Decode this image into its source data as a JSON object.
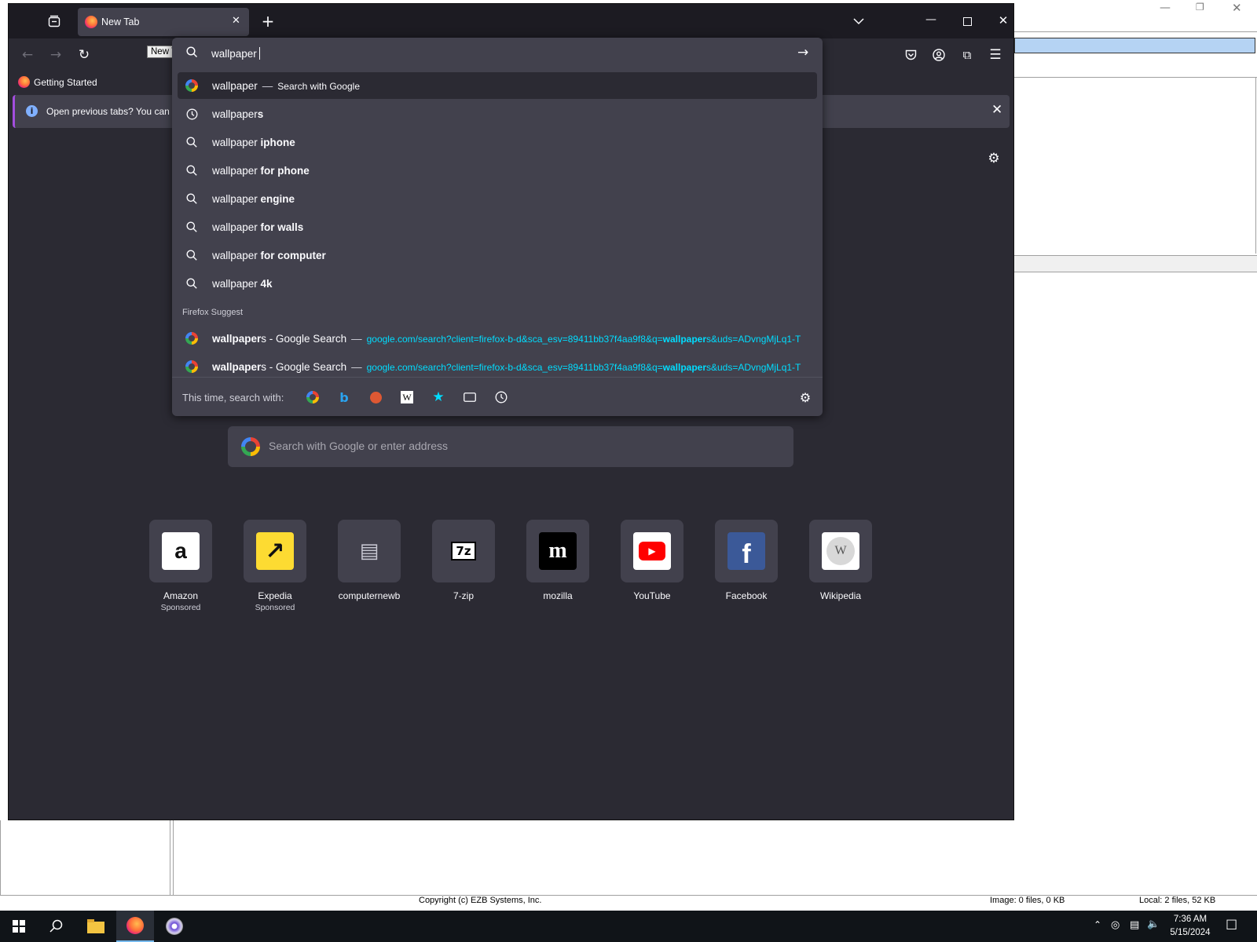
{
  "browser": {
    "tab_title": "New Tab",
    "tooltip": "New Tab",
    "bookmark": "Getting Started",
    "infobar_text": "Open previous tabs? You can re"
  },
  "urlbar": {
    "value": "wallpaper",
    "suggestions": [
      {
        "icon": "google-icon",
        "prefix": "wallpaper",
        "bold": "",
        "action": "Search with Google",
        "selected": true
      },
      {
        "icon": "history-icon",
        "prefix": "wallpaper",
        "bold": "s"
      },
      {
        "icon": "search-icon",
        "prefix": "wallpaper ",
        "bold": "iphone"
      },
      {
        "icon": "search-icon",
        "prefix": "wallpaper ",
        "bold": "for phone"
      },
      {
        "icon": "search-icon",
        "prefix": "wallpaper ",
        "bold": "engine"
      },
      {
        "icon": "search-icon",
        "prefix": "wallpaper ",
        "bold": "for walls"
      },
      {
        "icon": "search-icon",
        "prefix": "wallpaper ",
        "bold": "for computer"
      },
      {
        "icon": "search-icon",
        "prefix": "wallpaper ",
        "bold": "4k"
      }
    ],
    "suggest_label": "Firefox Suggest",
    "suggest_items": [
      {
        "bold": "wallpaper",
        "rest": "s - Google Search",
        "url_pre": "google.com/search?client=firefox-b-d&sca_esv=89411bb37f4aa9f8&q=",
        "url_bold": "wallpaper",
        "url_post": "s&uds=ADvngMjLq1-T"
      },
      {
        "bold": "wallpaper",
        "rest": "s - Google Search",
        "url_pre": "google.com/search?client=firefox-b-d&sca_esv=89411bb37f4aa9f8&q=",
        "url_bold": "wallpaper",
        "url_post": "s&uds=ADvngMjLq1-T"
      }
    ],
    "oneoff_label": "This time, search with:"
  },
  "home": {
    "search_placeholder": "Search with Google or enter address",
    "top_sites": [
      {
        "label": "Amazon",
        "sub": "Sponsored",
        "icon": "amazon-icon"
      },
      {
        "label": "Expedia",
        "sub": "Sponsored",
        "icon": "expedia-icon"
      },
      {
        "label": "computernewb",
        "sub": "",
        "icon": "computernewb-icon"
      },
      {
        "label": "7-zip",
        "sub": "",
        "icon": "7zip-icon"
      },
      {
        "label": "mozilla",
        "sub": "",
        "icon": "mozilla-icon"
      },
      {
        "label": "YouTube",
        "sub": "",
        "icon": "youtube-icon"
      },
      {
        "label": "Facebook",
        "sub": "",
        "icon": "facebook-icon"
      },
      {
        "label": "Wikipedia",
        "sub": "",
        "icon": "wikipedia-icon"
      }
    ]
  },
  "background_app": {
    "copyright": "Copyright (c) EZB Systems, Inc.",
    "image_status": "Image: 0 files, 0 KB",
    "local_status": "Local: 2 files, 52 KB"
  },
  "taskbar": {
    "time": "7:36 AM",
    "date": "5/15/2024"
  },
  "colors": {
    "accent_link": "#00ddff",
    "panel": "#42414d",
    "background": "#2b2a33"
  }
}
